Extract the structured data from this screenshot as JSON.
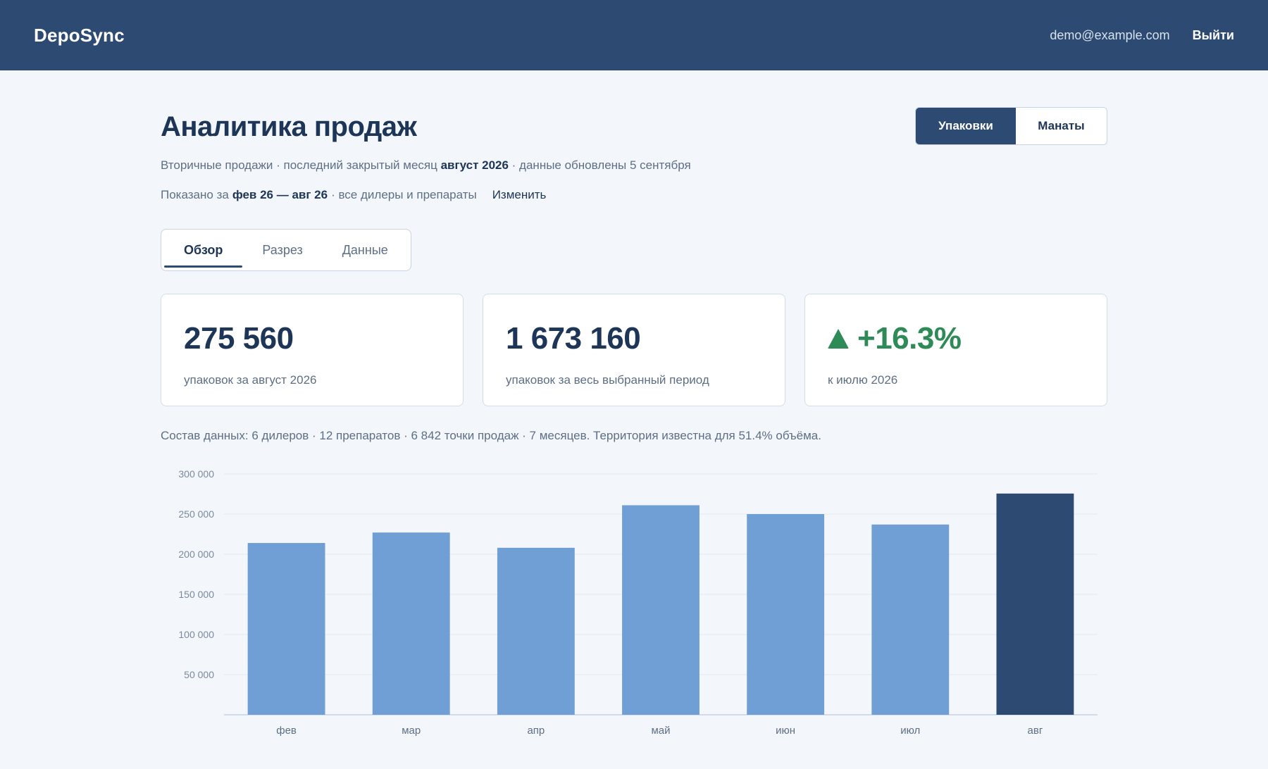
{
  "header": {
    "brand": "DepoSync",
    "user_email": "demo@example.com",
    "logout_label": "Выйти"
  },
  "page": {
    "title": "Аналитика продаж",
    "subtitle_prefix": "Вторичные продажи · последний закрытый месяц",
    "subtitle_month": "август 2026",
    "subtitle_suffix": "· данные обновлены 5 сентября",
    "period_prefix": "Показано за",
    "period_range": "фев 26 — авг 26",
    "period_suffix": "· все дилеры и препараты",
    "change_label": "Изменить"
  },
  "unit_toggle": {
    "options": [
      "Упаковки",
      "Манаты"
    ],
    "selected": "Упаковки"
  },
  "tabs": [
    {
      "label": "Обзор",
      "active": true
    },
    {
      "label": "Разрез",
      "active": false
    },
    {
      "label": "Данные",
      "active": false
    }
  ],
  "kpis": [
    {
      "value": "275 560",
      "label": "упаковок за август 2026"
    },
    {
      "value": "1 673 160",
      "label": "упаковок за весь выбранный период"
    },
    {
      "value": "+16.3%",
      "label": "к июлю 2026",
      "trend": "up"
    }
  ],
  "composition": "Состав данных: 6 дилеров · 12 препаратов · 6 842 точки продаж · 7 месяцев. Территория известна для 51.4% объёма.",
  "colors": {
    "bar": "#6f9fd4",
    "bar_highlight": "#2c4a72",
    "up": "#2e8b57"
  },
  "chart_data": {
    "type": "bar",
    "categories": [
      "фев",
      "мар",
      "апр",
      "май",
      "июн",
      "июл",
      "авг"
    ],
    "values": [
      214000,
      227000,
      208000,
      261000,
      250000,
      237000,
      275560
    ],
    "highlight_index": 6,
    "ylim": [
      0,
      300000
    ],
    "yticks": [
      50000,
      100000,
      150000,
      200000,
      250000,
      300000
    ],
    "ytick_labels": [
      "50 000",
      "100 000",
      "150 000",
      "200 000",
      "250 000",
      "300 000"
    ],
    "grid": true,
    "title": "",
    "xlabel": "",
    "ylabel": ""
  }
}
